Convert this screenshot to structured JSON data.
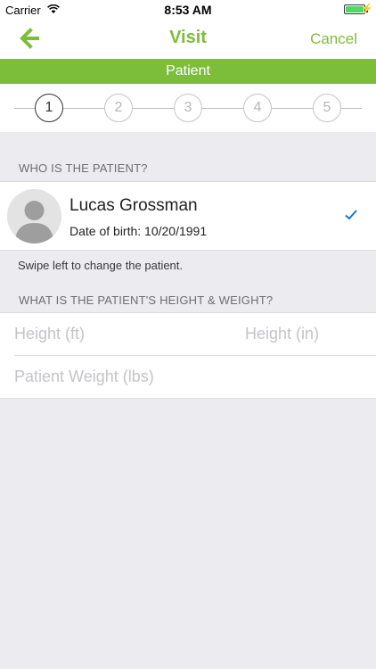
{
  "status_bar": {
    "carrier": "Carrier",
    "time": "8:53 AM"
  },
  "nav": {
    "title": "Visit",
    "cancel_label": "Cancel",
    "accent_color": "#7cbd3a"
  },
  "banner": {
    "label": "Patient"
  },
  "stepper": {
    "steps": [
      "1",
      "2",
      "3",
      "4",
      "5"
    ],
    "active_step": 1
  },
  "patient_section": {
    "header": "WHO IS THE PATIENT?",
    "patient": {
      "name": "Lucas Grossman",
      "dob": "Date of birth: 10/20/1991",
      "selected": true
    },
    "hint": "Swipe left to change the patient."
  },
  "measurements_section": {
    "header": "WHAT IS THE PATIENT'S HEIGHT & WEIGHT?",
    "height_ft_placeholder": "Height (ft)",
    "height_in_placeholder": "Height (in)",
    "weight_placeholder": "Patient Weight (lbs)"
  }
}
